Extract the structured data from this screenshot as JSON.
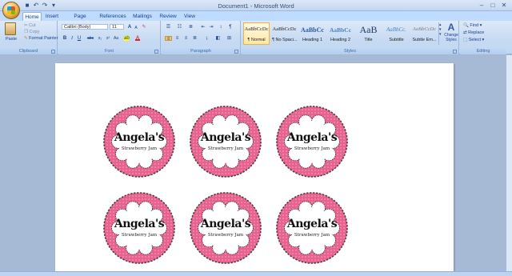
{
  "window": {
    "title": "Document1 - Microsoft Word",
    "controls": [
      "–",
      "□",
      "✕"
    ]
  },
  "tabs": [
    "Home",
    "Insert",
    "Page Layout",
    "References",
    "Mailings",
    "Review",
    "View"
  ],
  "clipboard": {
    "paste": "Paste",
    "cut": "Cut",
    "copy": "Copy",
    "format_painter": "Format Painter",
    "group_label": "Clipboard"
  },
  "font": {
    "font_name": "Calibri (Body)",
    "font_size": "11",
    "group_label": "Font"
  },
  "paragraph": {
    "group_label": "Paragraph"
  },
  "styles": {
    "items": [
      {
        "sample": "AaBbCcDc",
        "name": "¶ Normal"
      },
      {
        "sample": "AaBbCcDc",
        "name": "¶ No Spaci..."
      },
      {
        "sample": "AaBbCc",
        "name": "Heading 1"
      },
      {
        "sample": "AaBbCc",
        "name": "Heading 2"
      },
      {
        "sample": "AaB",
        "name": "Title"
      },
      {
        "sample": "AaBbCc.",
        "name": "Subtitle"
      },
      {
        "sample": "AaBbCcDc",
        "name": "Subtle Em..."
      }
    ],
    "change_styles": "Change Styles",
    "group_label": "Styles"
  },
  "editing": {
    "find": "Find",
    "replace": "Replace",
    "select": "Select",
    "group_label": "Editing"
  },
  "labels": [
    {
      "name": "Angela's",
      "sub": "Strawberry Jam"
    },
    {
      "name": "Angela's",
      "sub": "Strawberry Jam"
    },
    {
      "name": "Angela's",
      "sub": "Strawberry Jam"
    },
    {
      "name": "Angela's",
      "sub": "Strawberry Jam"
    },
    {
      "name": "Angela's",
      "sub": "Strawberry Jam"
    },
    {
      "name": "Angela's",
      "sub": "Strawberry Jam"
    }
  ],
  "colors": {
    "label_pink": "#e8628f",
    "label_dots": "#f7a9c3",
    "label_border": "#5a3a3a",
    "ribbon": "#c6daf3",
    "workspace": "#a6bad6"
  },
  "icons": {
    "office": "office-button-icon",
    "save": "save-icon",
    "undo": "undo-icon",
    "redo": "redo-icon"
  }
}
